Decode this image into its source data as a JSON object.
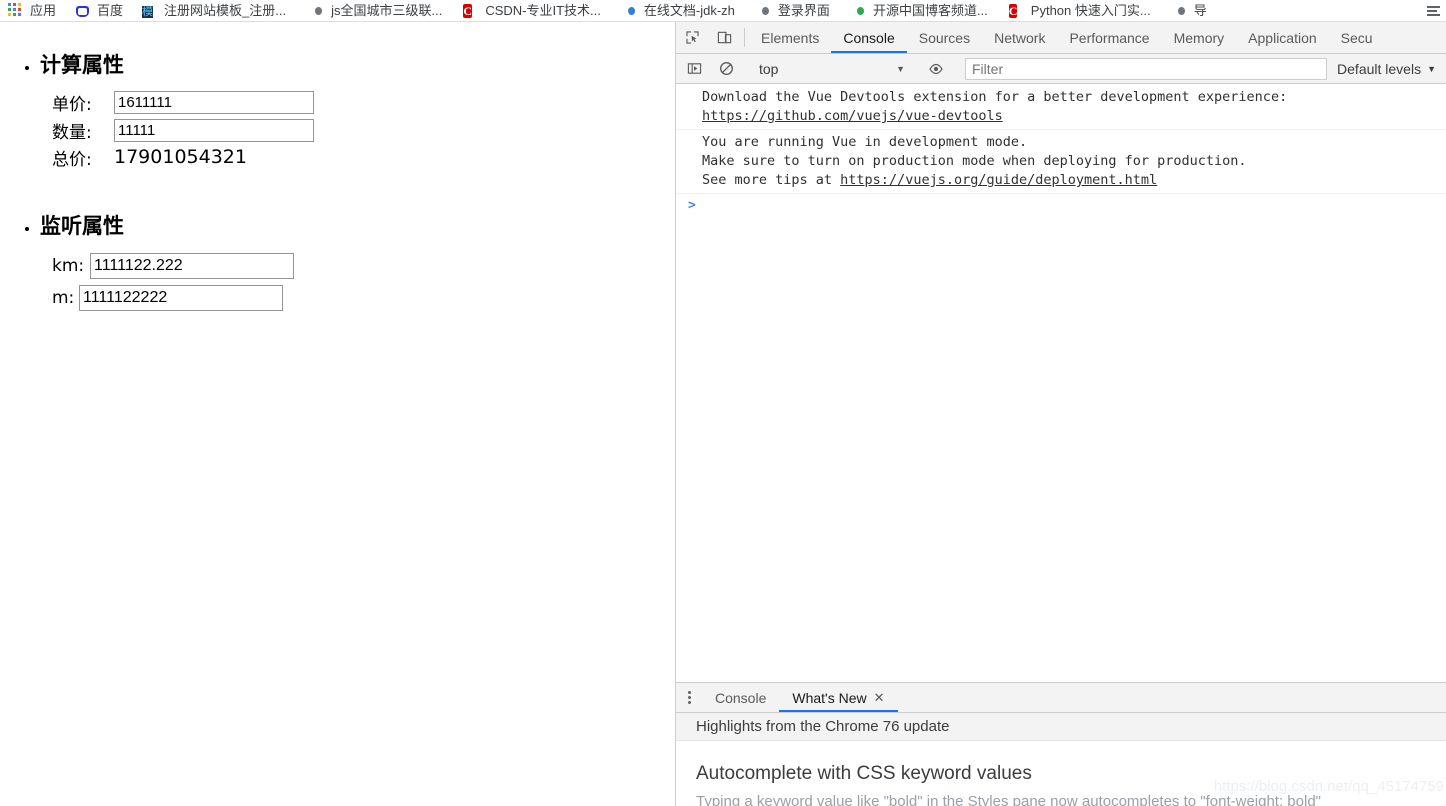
{
  "bookmarks": {
    "apps_label": "应用",
    "items": [
      {
        "label": "百度",
        "icon": "baidu-icon"
      },
      {
        "label": "注册网站模板_注册...",
        "icon": "site-icon"
      },
      {
        "label": "js全国城市三级联...",
        "icon": "globe-icon"
      },
      {
        "label": "CSDN-专业IT技术...",
        "icon": "csdn-icon"
      },
      {
        "label": "在线文档-jdk-zh",
        "icon": "globe-blue-icon"
      },
      {
        "label": "登录界面",
        "icon": "globe-icon"
      },
      {
        "label": "开源中国博客频道...",
        "icon": "globe-green-icon"
      },
      {
        "label": "Python 快速入门实...",
        "icon": "csdn-icon"
      },
      {
        "label": "导",
        "icon": "globe-icon"
      }
    ]
  },
  "page": {
    "sections": [
      {
        "heading": "计算属性",
        "rows": [
          {
            "label": "单价:",
            "value": "1611111",
            "type": "input"
          },
          {
            "label": "数量:",
            "value": "11111",
            "type": "input"
          },
          {
            "label": "总价:",
            "value": "17901054321",
            "type": "text"
          }
        ]
      },
      {
        "heading": "监听属性",
        "rows": [
          {
            "label": "km:",
            "value": "1111122.222",
            "type": "input"
          },
          {
            "label": "m:",
            "value": "1111122222",
            "type": "input"
          }
        ]
      }
    ]
  },
  "devtools": {
    "tabs": [
      {
        "label": "Elements",
        "active": false
      },
      {
        "label": "Console",
        "active": true
      },
      {
        "label": "Sources",
        "active": false
      },
      {
        "label": "Network",
        "active": false
      },
      {
        "label": "Performance",
        "active": false
      },
      {
        "label": "Memory",
        "active": false
      },
      {
        "label": "Application",
        "active": false
      },
      {
        "label": "Secu",
        "active": false
      }
    ],
    "inspect_icon": "inspect-element-icon",
    "device_icon": "device-toolbar-icon",
    "filterbar": {
      "sidebar_icon": "console-sidebar-icon",
      "clear_icon": "clear-console-icon",
      "context": "top",
      "caret": "▼",
      "eye_icon": "live-expression-eye-icon",
      "filter_placeholder": "Filter",
      "filter_value": "",
      "levels_label": "Default levels",
      "levels_caret": "▼"
    },
    "console": {
      "messages": [
        {
          "lines": [
            {
              "text": "Download the Vue Devtools extension for a better development experience:",
              "link": false
            },
            {
              "text": "https://github.com/vuejs/vue-devtools",
              "link": true
            }
          ]
        },
        {
          "lines": [
            {
              "text": "You are running Vue in development mode.",
              "link": false
            },
            {
              "text": "Make sure to turn on production mode when deploying for production.",
              "link": false
            },
            {
              "text": "See more tips at ",
              "link": false,
              "suffix_link": "https://vuejs.org/guide/deployment.html"
            }
          ]
        }
      ],
      "prompt": ">"
    },
    "drawer": {
      "kebab_icon": "more-options-icon",
      "tabs": [
        {
          "label": "Console",
          "active": false,
          "closable": false
        },
        {
          "label": "What's New",
          "active": true,
          "closable": true
        }
      ],
      "close_glyph": "✕",
      "subtitle": "Highlights from the Chrome 76 update",
      "article_title": "Autocomplete with CSS keyword values",
      "article_body": "Typing a keyword value like \"bold\" in the Styles pane now autocompletes to \"font-weight: bold\""
    }
  },
  "watermark": "https://blog.csdn.net/qq_45174759",
  "colors": {
    "accent": "#1a73e8",
    "link": "#303030",
    "prompt": "#4285f4",
    "toolbar_bg": "#f3f3f3",
    "border": "#cdcdcd"
  }
}
